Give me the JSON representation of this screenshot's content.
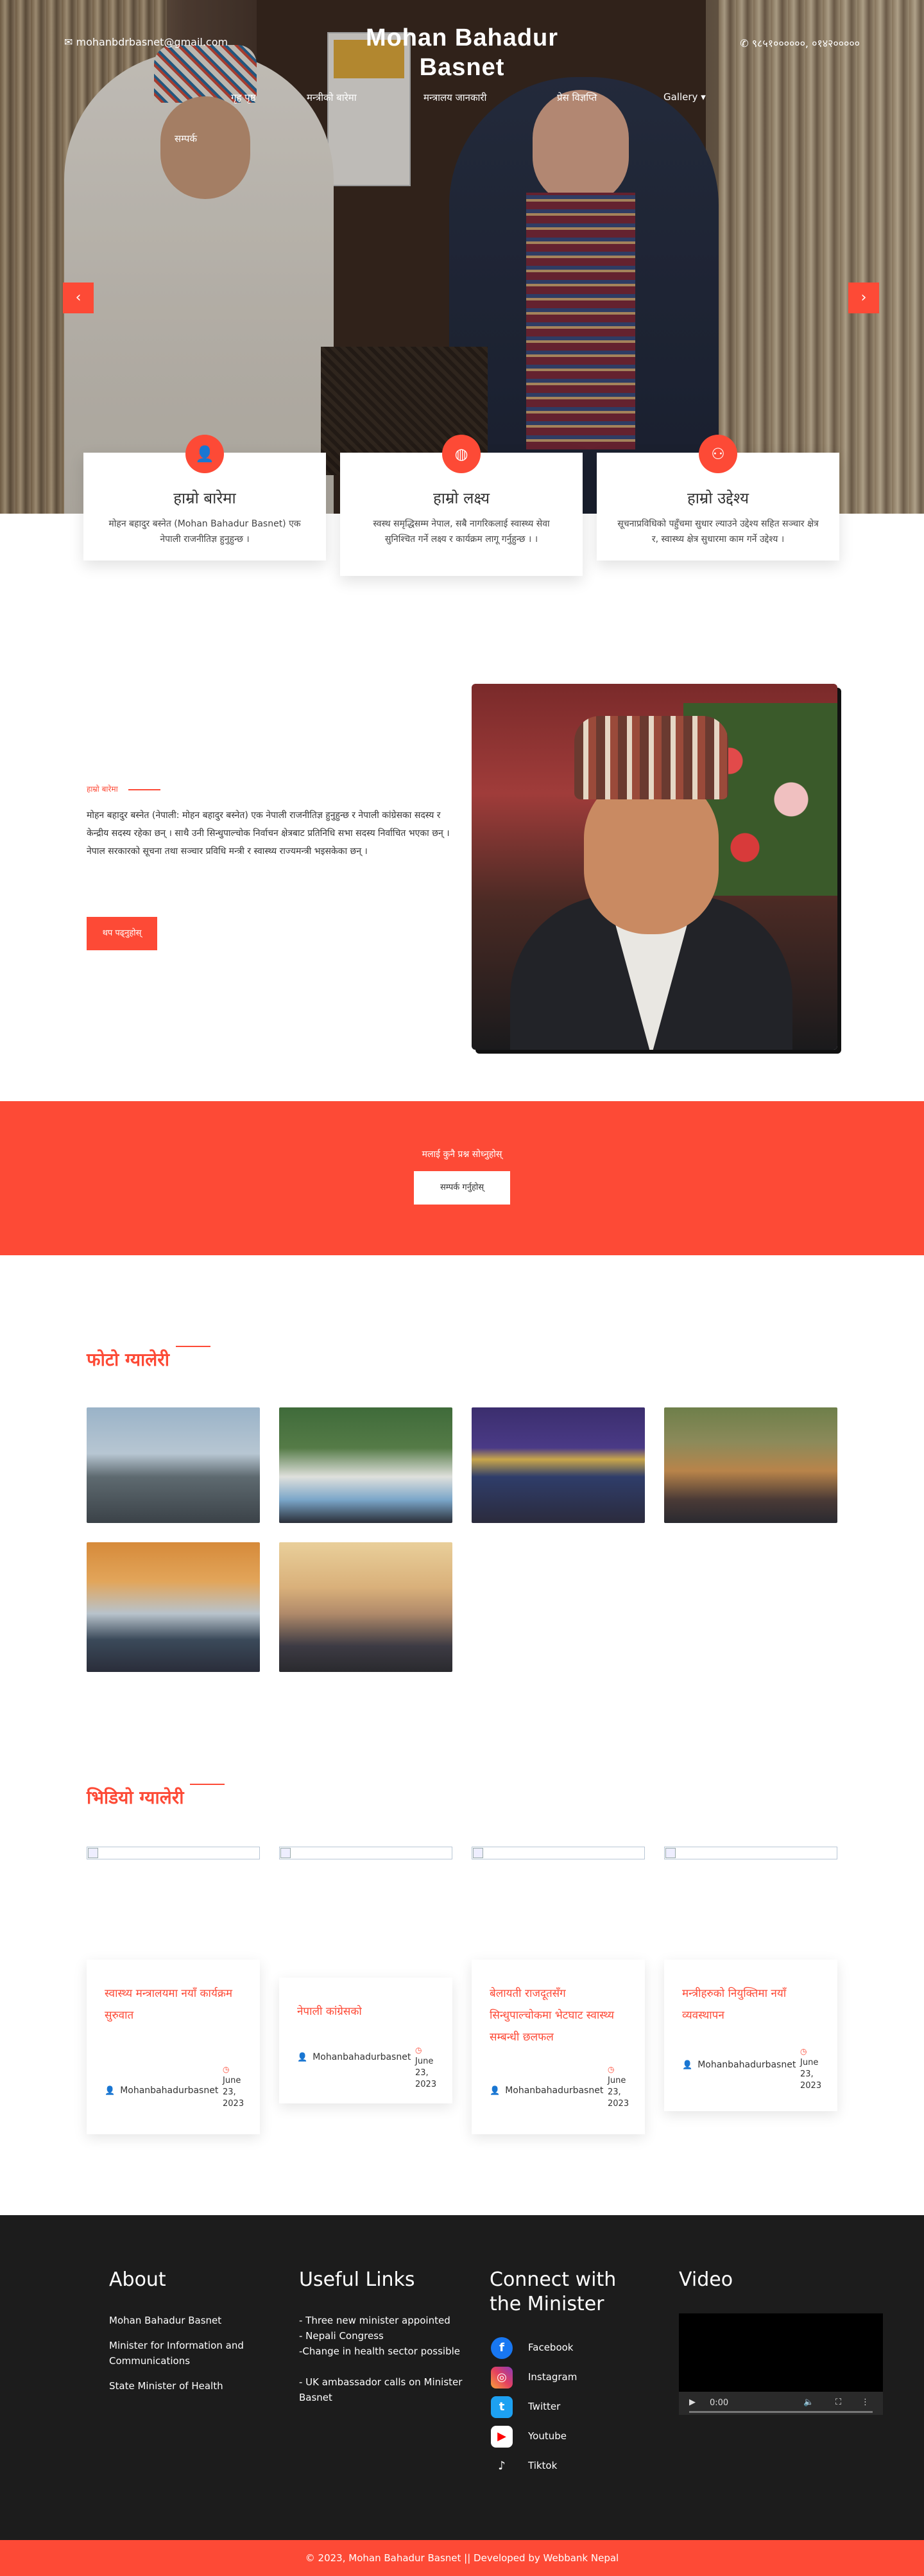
{
  "header": {
    "email": "mohanbdrbasnet@gmail.com",
    "phone": "९८५१००००००, ०१४२०००००",
    "title": "Mohan Bahadur Basnet",
    "nav": [
      "गृह पृष्ठ",
      "मन्त्रीको बारेमा",
      "मन्त्रालय जानकारी",
      "प्रेस विज्ञप्ति",
      "Gallery ▾",
      "सम्पर्क"
    ]
  },
  "hero": {
    "prev_arrow": "‹",
    "next_arrow": "›"
  },
  "cards": [
    {
      "icon": "user-icon",
      "title": "हाम्रो बारेमा",
      "text": "मोहन बहादुर बस्नेत (Mohan Bahadur Basnet) एक नेपाली राजनीतिज्ञ हुनुहुन्छ ।"
    },
    {
      "icon": "globe-icon",
      "title": "हाम्रो लक्ष्य",
      "text": "स्वस्थ समृद्धिसम्म नेपाल, सबै नागरिकलाई स्वास्थ्य सेवा सुनिश्चित गर्ने लक्ष्य र कार्यक्रम लागू गर्नुहुन्छ । ।"
    },
    {
      "icon": "network-icon",
      "title": "हाम्रो उद्देश्य",
      "text": "सूचनाप्रविधिको पहुँचमा सुधार ल्याउने उद्देश्य सहित सञ्चार क्षेत्र र, स्वास्थ्य क्षेत्र सुधारमा काम गर्ने उद्देश्य ।"
    }
  ],
  "about": {
    "label": "हाम्रो बारेमा",
    "text": "मोहन बहादुर बस्नेत (नेपाली: मोहन बहादुर बस्नेत) एक नेपाली राजनीतिज्ञ हुनुहुन्छ र नेपाली कांग्रेसका सदस्य र केन्द्रीय सदस्य रहेका छन् । साथै उनी सिन्धुपाल्चोक निर्वाचन क्षेत्रबाट प्रतिनिधि सभा सदस्य निर्वाचित भएका छन् । नेपाल सरकारको सूचना तथा सञ्चार प्रविधि मन्त्री र स्वास्थ्य राज्यमन्त्री भइसकेका छन् ।",
    "button": "थप पढ्नुहोस्"
  },
  "cta": {
    "text": "मलाई कुनै प्रश्न सोध्नुहोस्",
    "button": "सम्पर्क गर्नुहोस्"
  },
  "gallery": {
    "heading": "फोटो ग्यालेरी"
  },
  "videos": {
    "heading": "भिडियो ग्यालेरी"
  },
  "news": [
    {
      "title": "स्वास्थ्य मन्त्रालयमा नयाँ कार्यक्रम सुरुवात",
      "author": "Mohanbahadurbasnet",
      "date": "June 23, 2023"
    },
    {
      "title": "नेपाली कांग्रेसको",
      "author": "Mohanbahadurbasnet",
      "date": "June 23, 2023"
    },
    {
      "title": "बेलायती राजदूतसँग सिन्धुपाल्चोकमा भेटघाट स्वास्थ्य सम्बन्धी छलफल",
      "author": "Mohanbahadurbasnet",
      "date": "June 23, 2023"
    },
    {
      "title": "मन्त्रीहरुको नियुक्तिमा नयाँ व्यवस्थापन",
      "author": "Mohanbahadurbasnet",
      "date": "June 23, 2023"
    }
  ],
  "footer": {
    "about": {
      "heading": "About",
      "lines": [
        "Mohan Bahadur Basnet",
        "Minister for Information and Communications",
        "State Minister of Health"
      ]
    },
    "links": {
      "heading": "Useful Links",
      "items": [
        "- Three new minister appointed",
        "- Nepali Congress",
        "-Change in health sector possible",
        "- UK ambassador calls on Minister Basnet"
      ]
    },
    "connect": {
      "heading": "Connect with the Minister",
      "items": [
        "Facebook",
        "Instagram",
        "Twitter",
        "Youtube",
        "Tiktok"
      ]
    },
    "video": {
      "heading": "Video",
      "time": "0:00"
    },
    "copyright": "© 2023, Mohan Bahadur Basnet || Developed by ",
    "developer": "Webbank Nepal"
  },
  "colors": {
    "accent": "#fd4a36",
    "footer_bg": "#1c1c1c"
  }
}
